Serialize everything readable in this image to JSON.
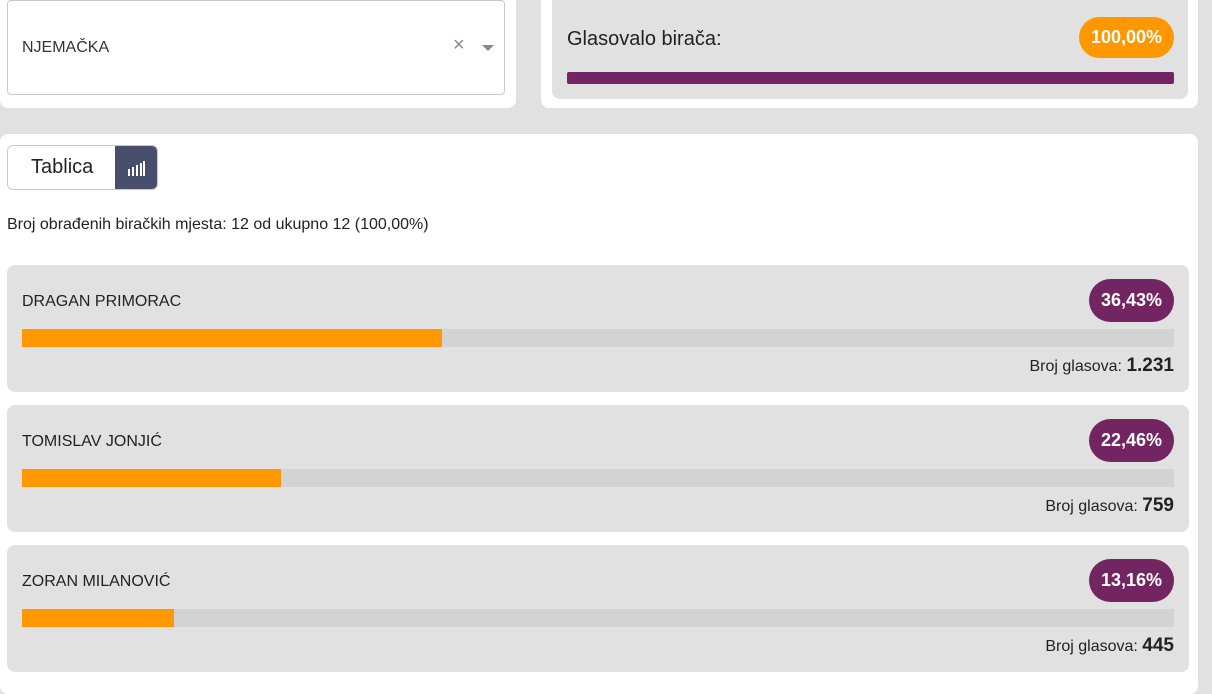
{
  "country_select": {
    "value": "NJEMAČKA",
    "clear_glyph": "×",
    "icons": {
      "clear": "close-icon",
      "dropdown": "chevron-down-icon"
    }
  },
  "turnout": {
    "label": "Glasovalo birača:",
    "value": "100,00%",
    "fill_percent": 100,
    "colors": {
      "bar": "#722561",
      "badge": "#ff9800"
    }
  },
  "view_toggle": {
    "table_label": "Tablica",
    "chart_icon": "bar-chart-icon",
    "chart_active": true
  },
  "counted_text": "Broj obrađenih biračkih mjesta: 12 od ukupno 12 (100,00%)",
  "votes_label": "Broj glasova:",
  "colors": {
    "accent": "#ff9800",
    "brand": "#722561",
    "toggle_active": "#474f6d"
  },
  "candidates": [
    {
      "name": "DRAGAN PRIMORAC",
      "percent": "36,43%",
      "share": 36.43,
      "votes": "1.231"
    },
    {
      "name": "TOMISLAV JONJIĆ",
      "percent": "22,46%",
      "share": 22.46,
      "votes": "759"
    },
    {
      "name": "ZORAN MILANOVIĆ",
      "percent": "13,16%",
      "share": 13.16,
      "votes": "445"
    }
  ]
}
